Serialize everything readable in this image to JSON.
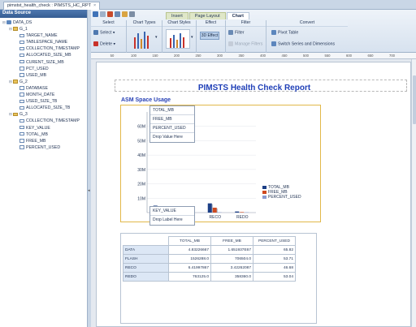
{
  "tab": {
    "title": "pimstst_health_check : PIMSTS_HC_RPT",
    "close": "×"
  },
  "datasource": {
    "header": "Data Source",
    "tree": [
      {
        "label": "DATA_DS",
        "kind": "db",
        "depth": 0
      },
      {
        "label": "G_1",
        "kind": "folder",
        "depth": 1
      },
      {
        "label": "TARGET_NAME",
        "kind": "field",
        "depth": 2
      },
      {
        "label": "TABLESPACE_NAME",
        "kind": "field",
        "depth": 2
      },
      {
        "label": "COLLECTION_TIMESTAMP",
        "kind": "field",
        "depth": 2
      },
      {
        "label": "ALLOCATED_SIZE_MB",
        "kind": "field",
        "depth": 2
      },
      {
        "label": "CURENT_SIZE_MB",
        "kind": "field",
        "depth": 2
      },
      {
        "label": "PCT_USED",
        "kind": "field",
        "depth": 2
      },
      {
        "label": "USED_MB",
        "kind": "field",
        "depth": 2
      },
      {
        "label": "G_2",
        "kind": "folder",
        "depth": 1
      },
      {
        "label": "DATABASE",
        "kind": "field",
        "depth": 2
      },
      {
        "label": "MONTH_DATE",
        "kind": "field",
        "depth": 2
      },
      {
        "label": "USED_SIZE_TB",
        "kind": "field",
        "depth": 2
      },
      {
        "label": "ALLOCATED_SIZE_TB",
        "kind": "field",
        "depth": 2
      },
      {
        "label": "G_3",
        "kind": "folder",
        "depth": 1
      },
      {
        "label": "COLLECTION_TIMESTAMP",
        "kind": "field",
        "depth": 2
      },
      {
        "label": "KEY_VALUE",
        "kind": "field",
        "depth": 2
      },
      {
        "label": "TOTAL_MB",
        "kind": "field",
        "depth": 2
      },
      {
        "label": "FREE_MB",
        "kind": "field",
        "depth": 2
      },
      {
        "label": "PERCENT_USED",
        "kind": "field",
        "depth": 2
      }
    ]
  },
  "ribbon": {
    "tabs": [
      "Insert",
      "Page Layout",
      "Chart"
    ],
    "active_tab": "Chart",
    "groups": {
      "select": {
        "title": "Select",
        "select_label": "Select",
        "delete_label": "Delete"
      },
      "chart_types": {
        "title": "Chart Types"
      },
      "chart_styles": {
        "title": "Chart Styles"
      },
      "effect": {
        "title": "Effect",
        "effect_label": "3D Effect"
      },
      "filter": {
        "title": "Filter",
        "filter_label": "Filter",
        "manage_label": "Manage Filters"
      },
      "convert": {
        "title": "Convert",
        "pivot_label": "Pivot Table",
        "switch_label": "Switch Series and Dimensions"
      }
    }
  },
  "ruler": [
    "50",
    "100",
    "150",
    "200",
    "250",
    "300",
    "350",
    "400",
    "450",
    "500",
    "550",
    "600",
    "650",
    "700"
  ],
  "report": {
    "title": "PIMSTS Health Check Report",
    "section_title": "ASM Space Usage",
    "drop_values": [
      "TOTAL_MB",
      "FREE_MB",
      "PERCENT_USED",
      "Drop Value Here"
    ],
    "drop_labels": [
      "KEY_VALUE",
      "Drop Label Here"
    ]
  },
  "chart_data": {
    "type": "bar",
    "categories": [
      "DATA",
      "FLASH",
      "RECO",
      "REDO"
    ],
    "series": [
      {
        "name": "TOTAL_MB",
        "values": [
          4832226.67,
          1526288.0,
          6419947.87,
          763125.0
        ]
      },
      {
        "name": "FREE_MB",
        "values": [
          1651937.67,
          706504.0,
          3422626.87,
          358360.0
        ]
      },
      {
        "name": "PERCENT_USED",
        "values": [
          65.82,
          53.71,
          46.68,
          53.04
        ]
      }
    ],
    "y_tick_labels": [
      "10M",
      "20M",
      "30M",
      "40M",
      "50M",
      "60M"
    ],
    "ylim": [
      0,
      70000000
    ],
    "legend_position": "right",
    "colors": {
      "TOTAL_MB": "#1c3f86",
      "FREE_MB": "#cf4a20",
      "PERCENT_USED": "#8a9bd0"
    }
  },
  "table": {
    "headers": [
      "TOTAL_MB",
      "FREE_MB",
      "PERCENT_USED"
    ],
    "rows": [
      {
        "label": "DATA",
        "values": [
          "4.83226667",
          "1.651937E67",
          "65.82"
        ]
      },
      {
        "label": "FLASH",
        "values": [
          "1526288.0",
          "706504.0",
          "53.71"
        ]
      },
      {
        "label": "RECO",
        "values": [
          "6.41997867",
          "3.42262087",
          "46.68"
        ]
      },
      {
        "label": "REDO",
        "values": [
          "763125.0",
          "358360.0",
          "53.04"
        ]
      }
    ]
  }
}
